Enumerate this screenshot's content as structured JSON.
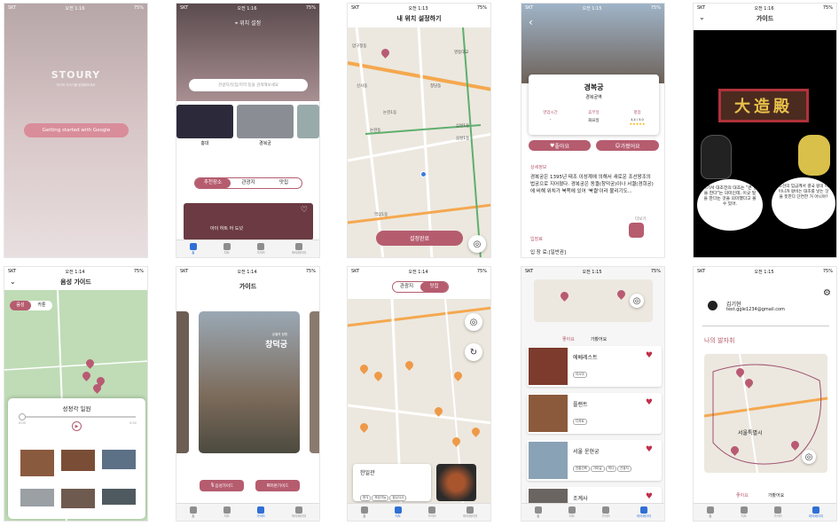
{
  "status": {
    "carrier": "SKT",
    "time_a": "오전 1:16",
    "time_b": "오전 1:13",
    "time_c": "오전 1:15",
    "time_d": "오전 1:14",
    "battery": "75%"
  },
  "tabs": [
    "홈",
    "지도",
    "가이드",
    "마이페이지"
  ],
  "s1": {
    "logo": "STOURY",
    "tag": "여기의 이야기를 탐험해보세요",
    "btn": "Getting started with Google"
  },
  "s2": {
    "location": "위치 설정",
    "search_ph": "관광지/맛집/지역 등을 검색해보세요",
    "thumbs": [
      "홍대",
      "경복궁"
    ],
    "seg": [
      "추천장소",
      "관광지",
      "맛집"
    ],
    "banner": "아이 하트 어 도넛"
  },
  "s3": {
    "title": "내 위치 설정하기",
    "btn": "설정완료",
    "places": [
      "압구정동",
      "영등대교",
      "신사동",
      "청담동",
      "논현1동",
      "논현동",
      "삼성1동",
      "삼성1동",
      "역삼1동"
    ]
  },
  "s4": {
    "name": "경복궁",
    "sub": "경복궁역",
    "cols": [
      {
        "h": "영업시간",
        "v": "-"
      },
      {
        "h": "휴무일",
        "v": "화요일"
      },
      {
        "h": "평점",
        "v": "4.4 / 5.0"
      }
    ],
    "like": "좋아요",
    "visit": "가봤어요",
    "sec": "상세정보",
    "desc": "경복궁은 1395년 태조 이성계에 의해서 새로운 조선왕조의 법궁으로 지어졌다. 경복궁은 동궐(창덕궁)이나 서궐(경희궁)에 비해 위치가 북쪽에 있어 '북궐'이라 불리기도...",
    "more": "더보기",
    "sec2": "입장료",
    "fee": "입 장 료:[일반권]"
  },
  "s5": {
    "title": "가이드",
    "sign": "大造殿",
    "left": "여기서 대조전의 대조는 \"큰 일을 한다\"는 의미인데, 이곳 일을 한다는 것을 의미했다고 볼 수 있어.",
    "right": "조선의 임금께서 결국 왕의 아이니까 왕비는 대조를 낳는 것을 뜻한다 단연한 거 아니야?"
  },
  "s6": {
    "title": "음성 가이드",
    "seg": [
      "음성",
      "카툰"
    ],
    "card": "성정각 일원",
    "t0": "0:00",
    "t1": "0:52"
  },
  "s7": {
    "title": "가이드",
    "sub": "궁궐의 정원",
    "name": "창덕궁",
    "b1": "음성가이드",
    "b2": "카툰가이드"
  },
  "s8": {
    "seg": [
      "관광지",
      "맛집"
    ],
    "card": "한일관",
    "tags": [
      "한식",
      "포장가능",
      "점심식사"
    ]
  },
  "s9": {
    "tabs": [
      "좋아요",
      "가봤어요"
    ],
    "items": [
      {
        "name": "에베레스트",
        "tags": [
          "아시아"
        ]
      },
      {
        "name": "플랜트",
        "tags": [
          "디저트"
        ]
      },
      {
        "name": "서울 운현궁",
        "tags": [
          "전통건축",
          "가마길",
          "역사",
          "관광지"
        ]
      },
      {
        "name": "조계사",
        "tags": []
      }
    ]
  },
  "s10": {
    "user": "김기현",
    "email": "test.ggle1234@gmail.com",
    "title": "나의 발자취",
    "city": "서울특별시",
    "tabs": [
      "좋아요",
      "가봤어요"
    ]
  }
}
